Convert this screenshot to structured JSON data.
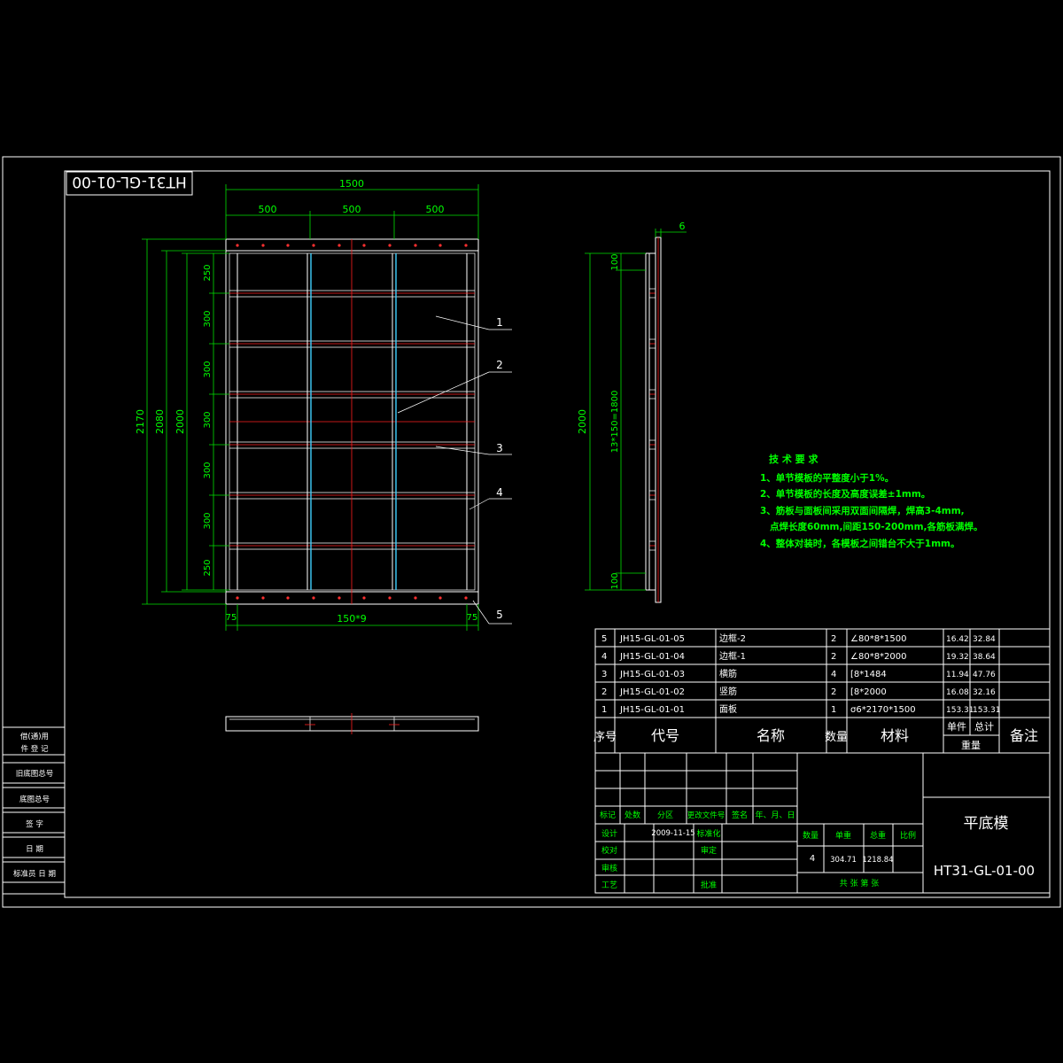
{
  "drawing": {
    "stamp_rotated": "HT31-GL-01-00",
    "top_dims": {
      "total": "1500",
      "seg1": "500",
      "seg2": "500",
      "seg3": "500"
    },
    "left_dims": {
      "h1": "2170",
      "h2": "2080",
      "h3": "2000",
      "rows": [
        "250",
        "300",
        "300",
        "300",
        "300",
        "300",
        "250"
      ]
    },
    "bottom_dims": {
      "left": "75",
      "mid": "150*9",
      "right": "75"
    },
    "callouts": [
      "1",
      "2",
      "3",
      "4",
      "5"
    ],
    "side_view": {
      "thickness": "6",
      "top": "100",
      "mid": "13*150=1800",
      "bottom": "100",
      "total": "2000"
    }
  },
  "tech": {
    "title": "技 术 要 求",
    "lines": [
      "1、单节模板的平整度小于1%。",
      "2、单节模板的长度及高度误差±1mm。",
      "3、筋板与面板间采用双面间隔焊，焊高3-4mm,",
      "   点焊长度60mm,间距150-200mm,各筋板满焊。",
      "4、整体对装时，各模板之间错台不大于1mm。"
    ]
  },
  "bom": {
    "rows": [
      {
        "no": "5",
        "code": "JH15-GL-01-05",
        "name": "边框-2",
        "qty": "2",
        "mat": "∠80*8*1500",
        "unit": "16.42",
        "total": "32.84"
      },
      {
        "no": "4",
        "code": "JH15-GL-01-04",
        "name": "边框-1",
        "qty": "2",
        "mat": "∠80*8*2000",
        "unit": "19.32",
        "total": "38.64"
      },
      {
        "no": "3",
        "code": "JH15-GL-01-03",
        "name": "横筋",
        "qty": "4",
        "mat": "[8*1484",
        "unit": "11.94",
        "total": "47.76"
      },
      {
        "no": "2",
        "code": "JH15-GL-01-02",
        "name": "竖筋",
        "qty": "2",
        "mat": "[8*2000",
        "unit": "16.08",
        "total": "32.16"
      },
      {
        "no": "1",
        "code": "JH15-GL-01-01",
        "name": "面板",
        "qty": "1",
        "mat": "σ6*2170*1500",
        "unit": "153.31",
        "total": "153.31"
      }
    ],
    "headers": {
      "no": "序号",
      "code": "代号",
      "name": "名称",
      "qty": "数量",
      "mat": "材料",
      "unit": "单件",
      "total": "总计",
      "weight": "重量",
      "remark": "备注"
    }
  },
  "title_block": {
    "row_labels": [
      "标记",
      "处数",
      "分区",
      "更改文件号",
      "签名",
      "年、月、日"
    ],
    "design": "设计",
    "date": "2009-11-15",
    "std": "标准化",
    "check": "校对",
    "review": "审核",
    "craft": "工艺",
    "audit": "审定",
    "approve": "批准",
    "stage": "阶段标记",
    "weight_h": "重量",
    "ratio_h": "比例",
    "count_h": "数量",
    "unit_h": "单重",
    "total_h": "总重",
    "count": "4",
    "unit": "304.71",
    "total": "1218.84",
    "sheets": "共 张 第 张",
    "name": "平底模",
    "number": "HT31-GL-01-00"
  },
  "left_strip": [
    "借(通)用",
    "件 登 记",
    "旧底图总号",
    "底图总号",
    "签 字",
    "日 期",
    "标准员 日 期"
  ]
}
